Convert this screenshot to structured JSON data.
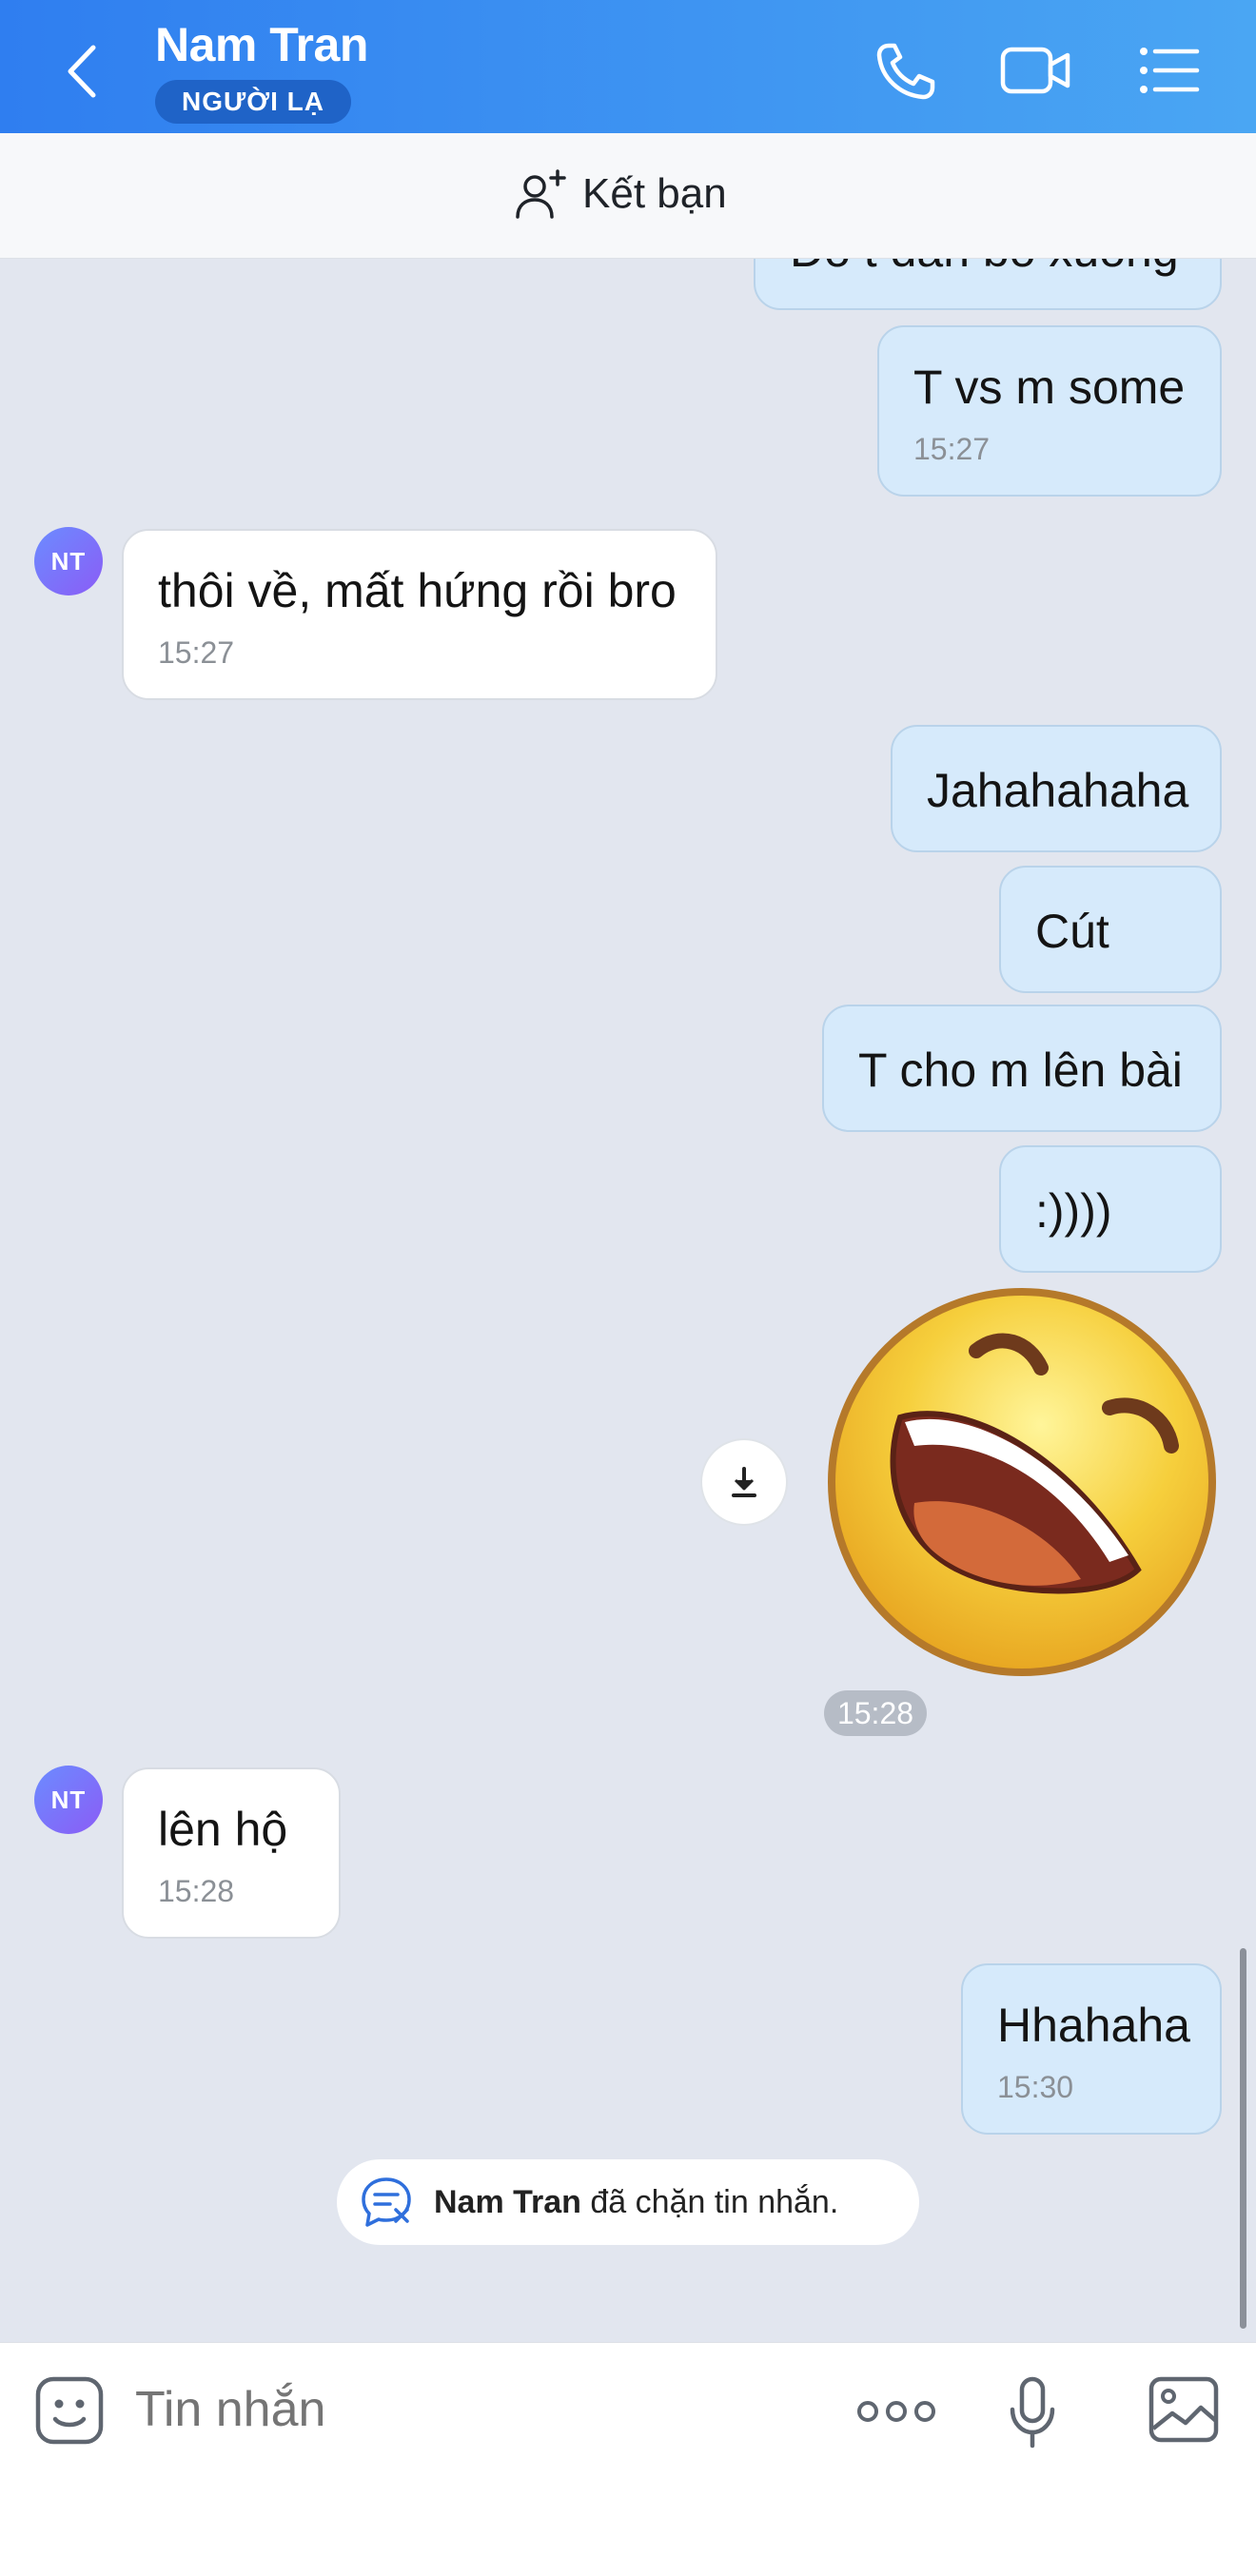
{
  "header": {
    "title": "Nam Tran",
    "badge": "NGƯỜI LẠ",
    "icons": [
      "back-arrow-icon",
      "phone-icon",
      "video-call-icon",
      "menu-list-icon"
    ],
    "accent_color": "#2f7ef0"
  },
  "friend_bar": {
    "label": "Kết bạn",
    "icon": "add-friend-icon"
  },
  "messages": {
    "m0": {
      "text": "Đo t đan bo xuong"
    },
    "m1": {
      "text": "T vs m some",
      "time": "15:27"
    },
    "m2": {
      "text": "thôi về, mất hứng rồi bro",
      "time": "15:27",
      "avatar": "NT"
    },
    "m3": {
      "text": "Jahahahaha"
    },
    "m4": {
      "text": "Cút"
    },
    "m5": {
      "text": "T cho m lên bài"
    },
    "m6": {
      "text": ":))))"
    },
    "sticker": {
      "name": "laughing-emoji-sticker",
      "time": "15:28"
    },
    "m7": {
      "text": "lên hộ",
      "time": "15:28",
      "avatar": "NT"
    },
    "m8": {
      "text": "Hhahaha",
      "time": "15:30"
    }
  },
  "notice": {
    "name": "Nam Tran",
    "text": " đã chặn tin nhắn."
  },
  "input": {
    "placeholder": "Tin nhắn",
    "icons": [
      "emoji-icon",
      "more-icon",
      "microphone-icon",
      "image-icon"
    ]
  }
}
